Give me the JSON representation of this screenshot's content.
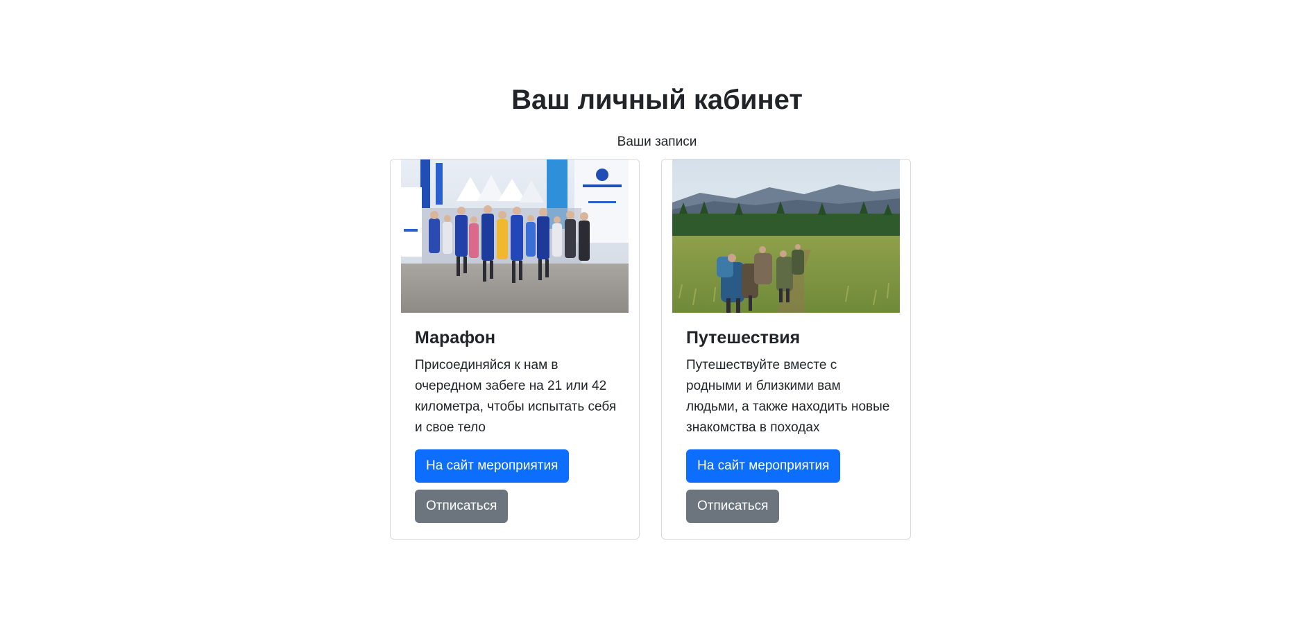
{
  "page": {
    "title": "Ваш личный кабинет",
    "subtitle": "Ваши записи"
  },
  "cards": [
    {
      "title": "Марафон",
      "text": "Присоединяйся к нам в очередном забеге на 21 или 42 километра, чтобы испытать себя и свое тело",
      "primary_button": "На сайт мероприятия",
      "secondary_button": "Отписаться",
      "image": "marathon-photo"
    },
    {
      "title": "Путешествия",
      "text": "Путешествуйте вместе с родными и близкими вам людьми, а также находить новые знакомства в походах",
      "primary_button": "На сайт мероприятия",
      "secondary_button": "Отписаться",
      "image": "hiking-photo"
    }
  ],
  "colors": {
    "primary": "#0d6efd",
    "secondary": "#6c757d",
    "text": "#212529",
    "border": "#d7d9dc"
  }
}
